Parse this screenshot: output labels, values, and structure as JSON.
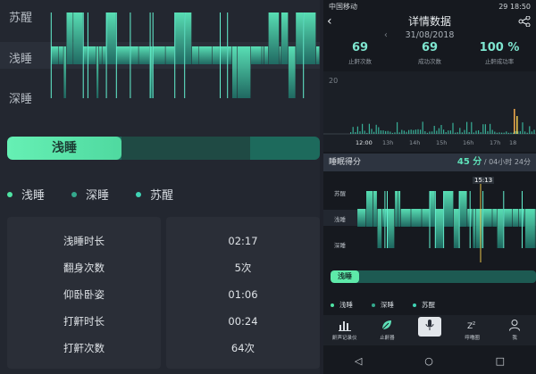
{
  "left": {
    "y_labels": [
      "苏醒",
      "浅睡",
      "深睡"
    ],
    "bar_label": "浅睡",
    "legend": [
      {
        "label": "浅睡",
        "color": "#4fe3a3"
      },
      {
        "label": "深睡",
        "color": "#34a88c"
      },
      {
        "label": "苏醒",
        "color": "#3fd3b4"
      }
    ],
    "stats_labels": [
      "浅睡时长",
      "翻身次数",
      "仰卧卧姿",
      "打鼾时长",
      "打鼾次数"
    ],
    "stats_values": [
      "02:17",
      "5次",
      "01:06",
      "00:24",
      "64次"
    ]
  },
  "status": {
    "carrier": "中国移动",
    "battery": "29",
    "time": "18:50"
  },
  "nav": {
    "back": "‹",
    "title": "详情数据"
  },
  "date": {
    "prev": "‹",
    "text": "31/08/2018"
  },
  "kpis": [
    {
      "value": "69",
      "label": "止鼾次数"
    },
    {
      "value": "69",
      "label": "成功次数"
    },
    {
      "value": "100 %",
      "label": "止鼾成功率"
    }
  ],
  "chart": {
    "y_top": "20",
    "x_ticks": [
      "12:00",
      "13h",
      "14h",
      "15h",
      "16h",
      "17h",
      "18"
    ]
  },
  "score": {
    "title": "睡眠得分",
    "value": "45 分",
    "duration": " / 04小时 24分"
  },
  "right_hyp": {
    "y_labels": [
      "苏醒",
      "浅睡",
      "深睡"
    ],
    "cursor_time": "15:13"
  },
  "right_bar": {
    "label": "浅睡"
  },
  "right_legend": [
    {
      "label": "浅睡",
      "color": "#4fe3a3"
    },
    {
      "label": "深睡",
      "color": "#34a88c"
    },
    {
      "label": "苏醒",
      "color": "#3fd3b4"
    }
  ],
  "tabs": [
    {
      "label": "鼾声记录仪",
      "icon": "bar-chart-icon"
    },
    {
      "label": "止鼾器",
      "icon": "leaf-icon"
    },
    {
      "label": "",
      "icon": "microphone-icon"
    },
    {
      "label": "呼噜圈",
      "icon": "zzz-icon"
    },
    {
      "label": "我",
      "icon": "user-icon"
    }
  ],
  "sysnav": {
    "back": "◁",
    "home": "○",
    "recent": "□"
  }
}
